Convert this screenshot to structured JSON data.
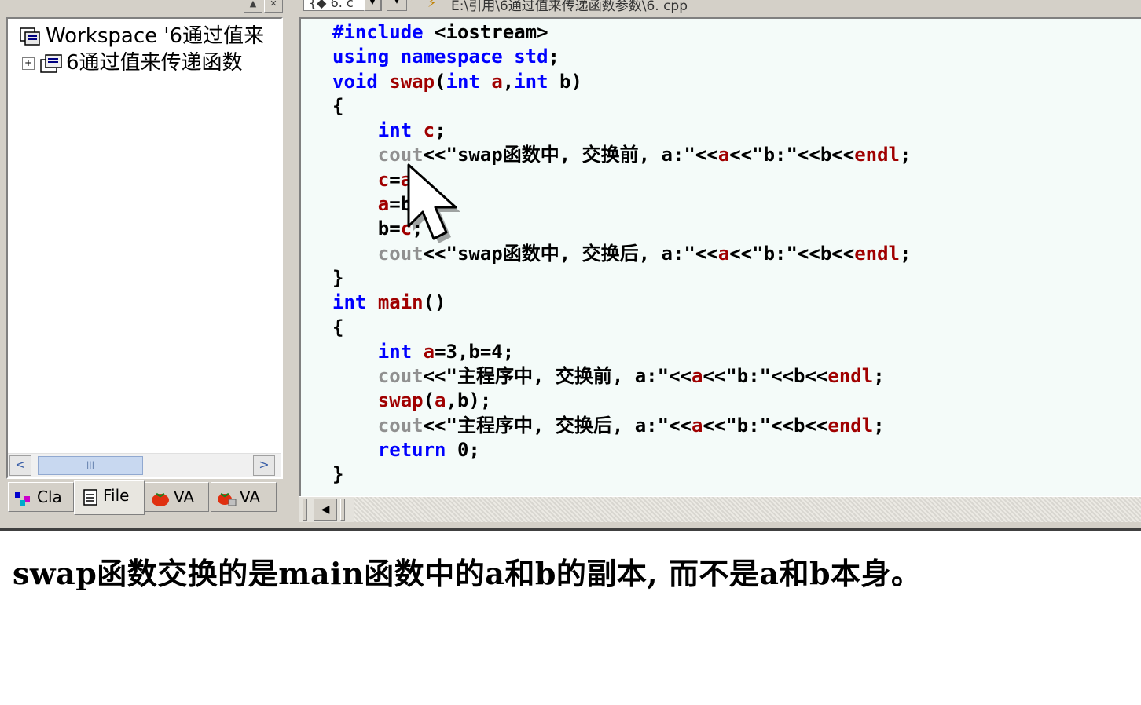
{
  "toolbar": {
    "class_combo_value": "{◆ 6. c",
    "file_path": "E:\\引用\\6通过值来传递函数参数\\6. cpp"
  },
  "workspace": {
    "root_label": "Workspace '6通过值来",
    "project_label": "6通过值来传递函数",
    "tabs": [
      {
        "label": "Cla"
      },
      {
        "label": "File"
      },
      {
        "label": "VA"
      },
      {
        "label": "VA"
      }
    ]
  },
  "editor": {
    "lines": [
      "#include <iostream>",
      "using namespace std;",
      "void swap(int a,int b)",
      "{",
      "    int c;",
      "    cout<<\"swap函数中, 交换前, a:\"<<a<<\"b:\"<<b<<endl;",
      "    c=a;",
      "    a=b;",
      "    b=c;",
      "    cout<<\"swap函数中, 交换后, a:\"<<a<<\"b:\"<<b<<endl;",
      "}",
      "int main()",
      "{",
      "    int a=3,b=4;",
      "    cout<<\"主程序中, 交换前, a:\"<<a<<\"b:\"<<b<<endl;",
      "    swap(a,b);",
      "    cout<<\"主程序中, 交换后, a:\"<<a<<\"b:\"<<b<<endl;",
      "    return 0;",
      "}"
    ]
  },
  "caption": {
    "text": "swap函数交换的是main函数中的a和b的副本, 而不是a和b本身。"
  },
  "colors": {
    "keyword": "#0000ff",
    "identifier": "#a00000",
    "cout": "#909090",
    "editor_bg": "#f4fbf9",
    "chrome": "#d4d0c8"
  }
}
